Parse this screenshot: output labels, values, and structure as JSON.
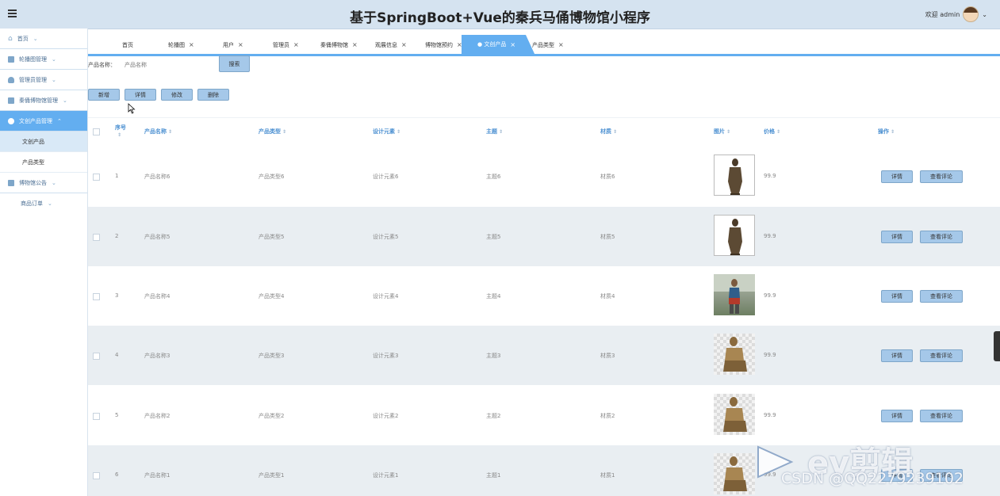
{
  "header": {
    "title": "基于SpringBoot+Vue的秦兵马俑博物馆小程序",
    "welcome": "欢迎 admin"
  },
  "sidebar": {
    "items": [
      {
        "label": "首页",
        "icon": "home-icon"
      },
      {
        "label": "轮播图管理",
        "icon": "grid-icon"
      },
      {
        "label": "管理员管理",
        "icon": "user-icon"
      },
      {
        "label": "秦俑博物馆管理",
        "icon": "grid-icon"
      },
      {
        "label": "文创产品管理",
        "icon": "product-icon"
      },
      {
        "label": "博物馆公告",
        "icon": "notice-icon"
      },
      {
        "label": "商品订单",
        "icon": "order-icon"
      }
    ],
    "submenu": [
      "文创产品",
      "产品类型"
    ]
  },
  "tabs": [
    "首页",
    "轮播图",
    "用户",
    "管理员",
    "秦俑博物馆",
    "观展信息",
    "博物馆预约",
    "文创产品",
    "产品类型"
  ],
  "active_tab": "● 文创产品",
  "search": {
    "label": "产品名称：",
    "placeholder": "产品名称",
    "button": "搜索"
  },
  "toolbar": {
    "add": "新增",
    "detail": "详情",
    "edit": "修改",
    "delete": "删除"
  },
  "table": {
    "headers": [
      "序号",
      "产品名称",
      "产品类型",
      "设计元素",
      "主题",
      "材质",
      "图片",
      "价格",
      "操作"
    ],
    "rows": [
      {
        "index": "1",
        "name": "产品名称6",
        "type": "产品类型6",
        "design": "设计元素6",
        "theme": "主题6",
        "material": "材质6",
        "price": "99.9",
        "image": "warrior-standing"
      },
      {
        "index": "2",
        "name": "产品名称5",
        "type": "产品类型5",
        "design": "设计元素5",
        "theme": "主题5",
        "material": "材质5",
        "price": "99.9",
        "image": "warrior-standing"
      },
      {
        "index": "3",
        "name": "产品名称4",
        "type": "产品类型4",
        "design": "设计元素4",
        "theme": "主题4",
        "material": "材质4",
        "price": "99.9",
        "image": "warrior-photo"
      },
      {
        "index": "4",
        "name": "产品名称3",
        "type": "产品类型3",
        "design": "设计元素3",
        "theme": "主题3",
        "material": "材质3",
        "price": "99.9",
        "image": "warrior-kneeling"
      },
      {
        "index": "5",
        "name": "产品名称2",
        "type": "产品类型2",
        "design": "设计元素2",
        "theme": "主题2",
        "material": "材质2",
        "price": "99.9",
        "image": "warrior-kneeling"
      },
      {
        "index": "6",
        "name": "产品名称1",
        "type": "产品类型1",
        "design": "设计元素1",
        "theme": "主题1",
        "material": "材质1",
        "price": "99.9",
        "image": "warrior-kneeling"
      }
    ],
    "row_actions": {
      "detail": "详情",
      "comments": "查看评论"
    }
  },
  "overlay": {
    "ev_logo": "ev剪辑",
    "csdn": "CSDN @QQ2279239102"
  }
}
